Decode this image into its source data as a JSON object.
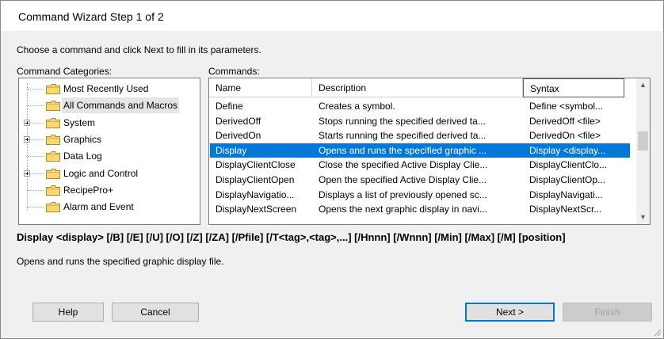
{
  "window": {
    "title": "Command Wizard Step 1 of 2"
  },
  "instruction": "Choose a command and click Next to fill in its parameters.",
  "categories": {
    "label": "Command Categories:",
    "items": [
      {
        "label": "Most Recently Used",
        "expandable": false
      },
      {
        "label": "All Commands and Macros",
        "expandable": false,
        "selected": true
      },
      {
        "label": "System",
        "expandable": true
      },
      {
        "label": "Graphics",
        "expandable": true
      },
      {
        "label": "Data Log",
        "expandable": false
      },
      {
        "label": "Logic and Control",
        "expandable": true
      },
      {
        "label": "RecipePro+",
        "expandable": false
      },
      {
        "label": "Alarm and Event",
        "expandable": false
      }
    ]
  },
  "commands": {
    "label": "Commands:",
    "columns": [
      "Name",
      "Description",
      "Syntax"
    ],
    "rows": [
      {
        "name": "Define",
        "description": "Creates a symbol.",
        "syntax": "Define <symbol..."
      },
      {
        "name": "DerivedOff",
        "description": "Stops running the specified derived ta...",
        "syntax": "DerivedOff <file>"
      },
      {
        "name": "DerivedOn",
        "description": "Starts running the specified derived ta...",
        "syntax": "DerivedOn <file>"
      },
      {
        "name": "Display",
        "description": "Opens and runs the specified graphic ...",
        "syntax": "Display <display...",
        "selected": true
      },
      {
        "name": "DisplayClientClose",
        "description": "Close the specified Active Display Clie...",
        "syntax": "DisplayClientClo..."
      },
      {
        "name": "DisplayClientOpen",
        "description": "Open the specified Active Display Clie...",
        "syntax": "DisplayClientOp..."
      },
      {
        "name": "DisplayNavigatio...",
        "description": "Displays a list of previously opened sc...",
        "syntax": "DisplayNavigati..."
      },
      {
        "name": "DisplayNextScreen",
        "description": "Opens the next graphic display in navi...",
        "syntax": "DisplayNextScr..."
      }
    ]
  },
  "selected_syntax": "Display <display> [/B] [/E] [/U] [/O] [/Z] [/ZA] [/Pfile] [/T<tag>,<tag>,...] [/Hnnn] [/Wnnn] [/Min] [/Max] [/M] [position]",
  "selected_description": "Opens and runs the specified graphic display file.",
  "buttons": {
    "help": "Help",
    "cancel": "Cancel",
    "next": "Next >",
    "finish": "Finish"
  },
  "colors": {
    "selection": "#0078d7",
    "folder": "#f5d76e"
  },
  "icons": {
    "folder": "folder-icon",
    "expand": "plus-expander-icon",
    "scroll_up": "chevron-up-icon",
    "scroll_down": "chevron-down-icon"
  }
}
